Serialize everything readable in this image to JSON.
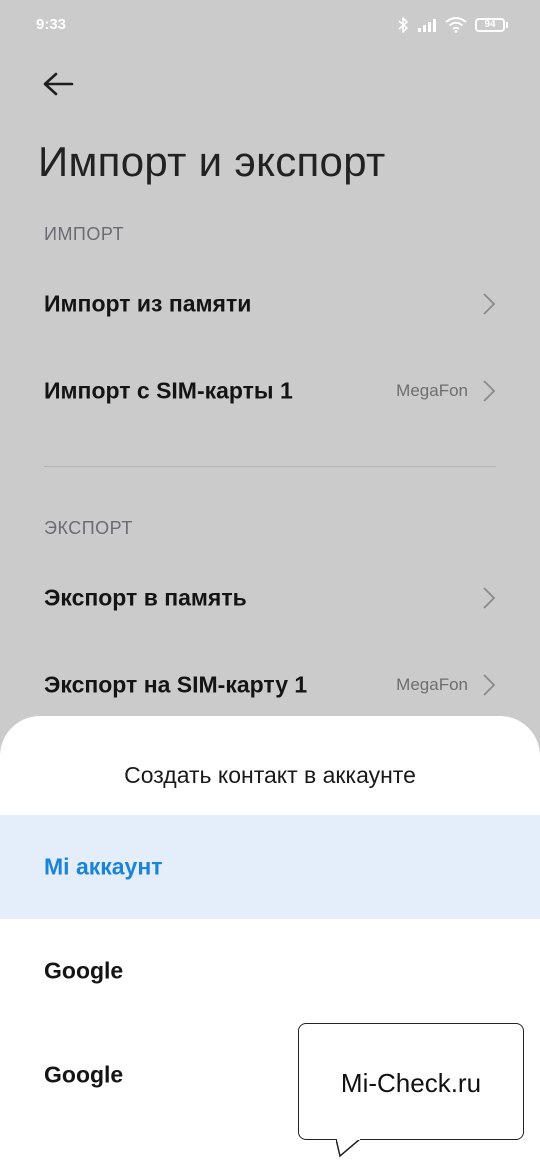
{
  "status_bar": {
    "time": "9:33",
    "battery": "94",
    "icons": [
      "bluetooth-icon",
      "signal-icon",
      "wifi-icon",
      "battery-icon"
    ]
  },
  "header": {
    "back_icon": "back-arrow-icon",
    "title": "Импорт и экспорт"
  },
  "import_section": {
    "label": "ИМПОРТ",
    "items": [
      {
        "label": "Импорт из памяти",
        "value": ""
      },
      {
        "label": "Импорт с SIM-карты 1",
        "value": "MegaFon"
      }
    ]
  },
  "export_section": {
    "label": "ЭКСПОРТ",
    "items": [
      {
        "label": "Экспорт в память",
        "value": ""
      },
      {
        "label": "Экспорт на SIM-карту 1",
        "value": "MegaFon"
      }
    ]
  },
  "sheet": {
    "title": "Создать контакт в аккаунте",
    "options": [
      {
        "label": "Mi аккаунт",
        "selected": true
      },
      {
        "label": "Google",
        "selected": false
      },
      {
        "label": "Google",
        "selected": false
      }
    ]
  },
  "watermark": {
    "text": "Mi-Check.ru"
  },
  "colors": {
    "accent": "#1a84d6",
    "selected_bg": "#e4eefa",
    "dim_overlay": "#cbcbcb"
  }
}
